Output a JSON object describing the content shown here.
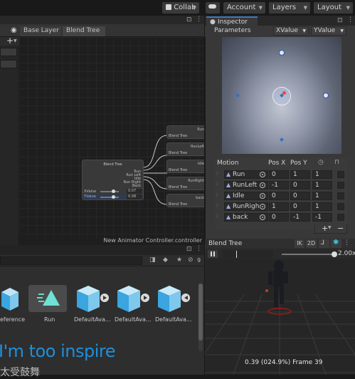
{
  "toolbar": {
    "collab_label": "Collab",
    "account_label": "Account",
    "layers_label": "Layers",
    "layout_label": "Layout"
  },
  "animator": {
    "breadcrumb": [
      "Base Layer",
      "Blend Tree"
    ],
    "footer": "New Animator Controller.controller",
    "root_node": {
      "title": "Blend Tree",
      "outputs": [
        "Run",
        "Run Left",
        "Idle",
        "Run Right",
        "Back"
      ],
      "params": [
        {
          "name": "XValue",
          "value": "0.07"
        },
        {
          "name": "YValue",
          "value": "0.08"
        }
      ]
    },
    "child_nodes": [
      {
        "label": "Run",
        "sub": "Blend Tree"
      },
      {
        "label": "RunLeft",
        "sub": "Blend Tree"
      },
      {
        "label": "Idle",
        "sub": "Blend Tree"
      },
      {
        "label": "RunRight",
        "sub": "Blend Tree"
      },
      {
        "label": "back",
        "sub": "Blend Tree"
      }
    ]
  },
  "inspector": {
    "tab_label": "Inspector",
    "parameters_label": "Parameters",
    "param_x": "XValue",
    "param_y": "YValue",
    "motion_headers": {
      "motion": "Motion",
      "pos_x": "Pos X",
      "pos_y": "Pos Y"
    },
    "motions": [
      {
        "name": "Run",
        "pos_x": "0",
        "pos_y": "1",
        "speed": "1"
      },
      {
        "name": "RunLeft",
        "pos_x": "-1",
        "pos_y": "0",
        "speed": "1"
      },
      {
        "name": "Idle",
        "pos_x": "0",
        "pos_y": "0",
        "speed": "1"
      },
      {
        "name": "RunRigh",
        "pos_x": "1",
        "pos_y": "0",
        "speed": "1"
      },
      {
        "name": "back",
        "pos_x": "0",
        "pos_y": "-1",
        "speed": "-1"
      }
    ]
  },
  "preview": {
    "title": "Blend Tree",
    "ik_label": "IK",
    "twod_label": "2D",
    "speed": "2.00x",
    "status": "0.39 (024.9%) Frame 39"
  },
  "project": {
    "hidden_count": "9",
    "assets": [
      "eference",
      "Run",
      "DefaultAva...",
      "DefaultAva...",
      "DefaultAva..."
    ]
  },
  "subtitle": {
    "line1": "I'm too inspire",
    "line2": "太受鼓舞"
  }
}
